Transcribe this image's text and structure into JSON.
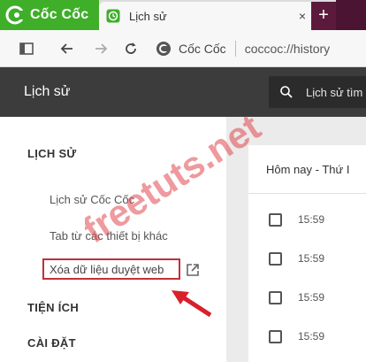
{
  "browser": {
    "brand_name": "Cốc Cốc",
    "tab_title": "Lịch sử",
    "tab_close": "×",
    "new_tab": "+",
    "omnibox_site": "Cốc Cốc",
    "omnibox_url": "coccoc://history",
    "brand_color": "#3fae29"
  },
  "header": {
    "title": "Lịch sử",
    "search_placeholder": "Lịch sử tìm"
  },
  "sidebar": {
    "section_history": "LỊCH SỬ",
    "items": [
      {
        "label": "Lịch sử Cốc Cốc"
      },
      {
        "label": "Tab từ các thiết bị khác"
      },
      {
        "label": "Xóa dữ liệu duyệt web"
      }
    ],
    "section_utilities": "TIỆN ÍCH",
    "section_settings": "CÀI ĐẶT"
  },
  "main": {
    "date_heading": "Hôm nay - Thứ I",
    "entries": [
      {
        "time": "15:59"
      },
      {
        "time": "15:59"
      },
      {
        "time": "15:59"
      },
      {
        "time": "15:59"
      }
    ]
  },
  "watermark": {
    "text": "freetuts.net",
    "color": "#e0474f"
  },
  "annotation": {
    "highlight_color": "#c0303a"
  }
}
